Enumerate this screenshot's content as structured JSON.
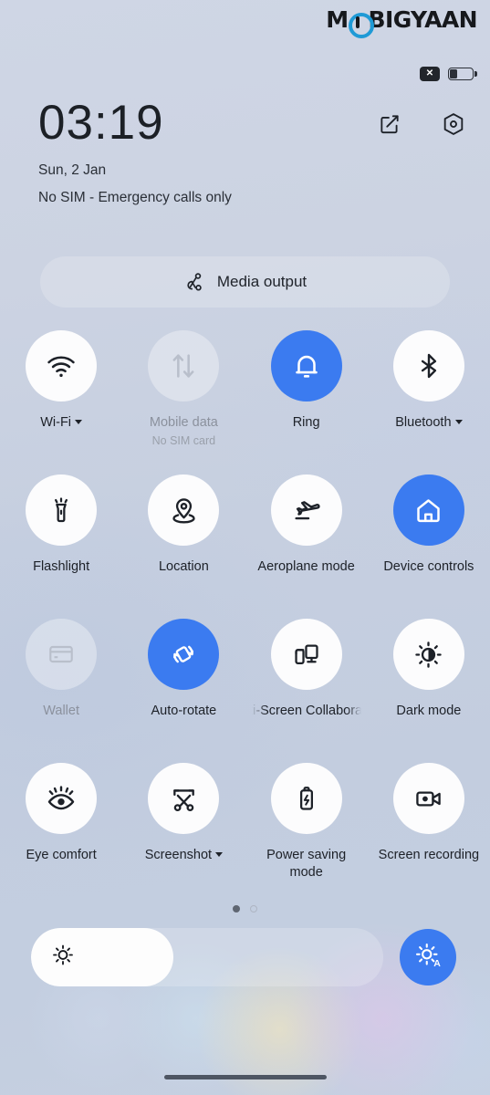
{
  "brand": {
    "name_before": "M",
    "name_after": "BIGYAAN"
  },
  "status_bar": {
    "no_sim_icon_label": "✕",
    "battery_level_percent": 30
  },
  "lockscreen": {
    "clock": "03:19",
    "date": "Sun, 2 Jan",
    "carrier": "No SIM - Emergency calls only",
    "edit_icon": "edit-icon",
    "settings_icon": "settings-hexagon-icon"
  },
  "media_output": {
    "label": "Media output",
    "icon": "media-cast-icon"
  },
  "toggles": [
    {
      "label": "Wi-Fi",
      "icon": "wifi-icon",
      "state": "on",
      "has_caret": true
    },
    {
      "label": "Mobile data",
      "sub": "No SIM card",
      "icon": "mobile-data-icon",
      "state": "disabled",
      "has_caret": false
    },
    {
      "label": "Ring",
      "icon": "bell-icon",
      "state": "active",
      "has_caret": false
    },
    {
      "label": "Bluetooth",
      "icon": "bluetooth-icon",
      "state": "on",
      "has_caret": true
    },
    {
      "label": "Flashlight",
      "icon": "flashlight-icon",
      "state": "on",
      "has_caret": false
    },
    {
      "label": "Location",
      "icon": "location-pin-icon",
      "state": "on",
      "has_caret": false
    },
    {
      "label": "Aeroplane mode",
      "icon": "airplane-icon",
      "state": "on",
      "has_caret": false
    },
    {
      "label": "Device controls",
      "icon": "home-house-icon",
      "state": "active",
      "has_caret": false
    },
    {
      "label": "Wallet",
      "icon": "credit-card-icon",
      "state": "disabled",
      "has_caret": false
    },
    {
      "label": "Auto-rotate",
      "icon": "auto-rotate-icon",
      "state": "active",
      "has_caret": false
    },
    {
      "label": "Multi-Screen Collaboration",
      "label_visible": "ulti-Screen Co",
      "icon": "multi-screen-icon",
      "state": "on",
      "has_caret": false,
      "truncated": true
    },
    {
      "label": "Dark mode",
      "icon": "dark-mode-icon",
      "state": "on",
      "has_caret": false
    },
    {
      "label": "Eye comfort",
      "icon": "eye-comfort-icon",
      "state": "on",
      "has_caret": false
    },
    {
      "label": "Screenshot",
      "icon": "screenshot-scissors-icon",
      "state": "on",
      "has_caret": true
    },
    {
      "label": "Power saving mode",
      "icon": "battery-bolt-icon",
      "state": "on",
      "has_caret": false
    },
    {
      "label": "Screen recording",
      "icon": "video-record-icon",
      "state": "on",
      "has_caret": false
    }
  ],
  "pager": {
    "pages": 2,
    "active_index": 0
  },
  "brightness": {
    "value_percent": 40,
    "slider_icon": "brightness-sun-icon",
    "auto_button_icon": "brightness-auto-icon",
    "auto_button_letter": "A"
  },
  "colors": {
    "accent_blue": "#3b7bf0",
    "tile_white": "#fcfcfd",
    "text_primary": "#1d2128",
    "text_dim": "#8b919d",
    "background": "#c6cfe0"
  },
  "home_indicator": "gesture-bar"
}
